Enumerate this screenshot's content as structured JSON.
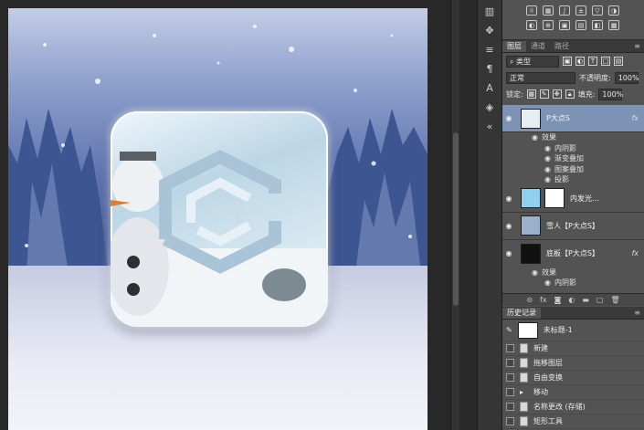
{
  "layers_panel": {
    "tabs": [
      "图层",
      "通道",
      "路径"
    ],
    "filter_kind": "类型",
    "blend_mode": "正常",
    "opacity_label": "不透明度:",
    "opacity_value": "100%",
    "lock_label": "锁定:",
    "fill_label": "填充:",
    "fill_value": "100%",
    "layers": [
      {
        "name": "P大点S",
        "fx": "fx",
        "selected": true,
        "effects_title": "效果",
        "effects": [
          "内阴影",
          "渐变叠加",
          "图案叠加",
          "投影"
        ]
      },
      {
        "name": "内发光...",
        "fx": ""
      },
      {
        "name": "雪人【P大点S】",
        "fx": ""
      },
      {
        "name": "底板【P大点S】",
        "fx": "fx",
        "effects_title": "效果",
        "effects": [
          "内阴影"
        ]
      }
    ]
  },
  "history_panel": {
    "tab": "历史记录",
    "snapshot": "未标题-1",
    "items": [
      "新建",
      "拖移图层",
      "自由变换",
      "移动",
      "名称更改 (存储)",
      "矩形工具"
    ]
  },
  "colors": {
    "selected_layer": "#7c93b6",
    "panel_bg": "#535353",
    "app_bg": "#282828"
  }
}
